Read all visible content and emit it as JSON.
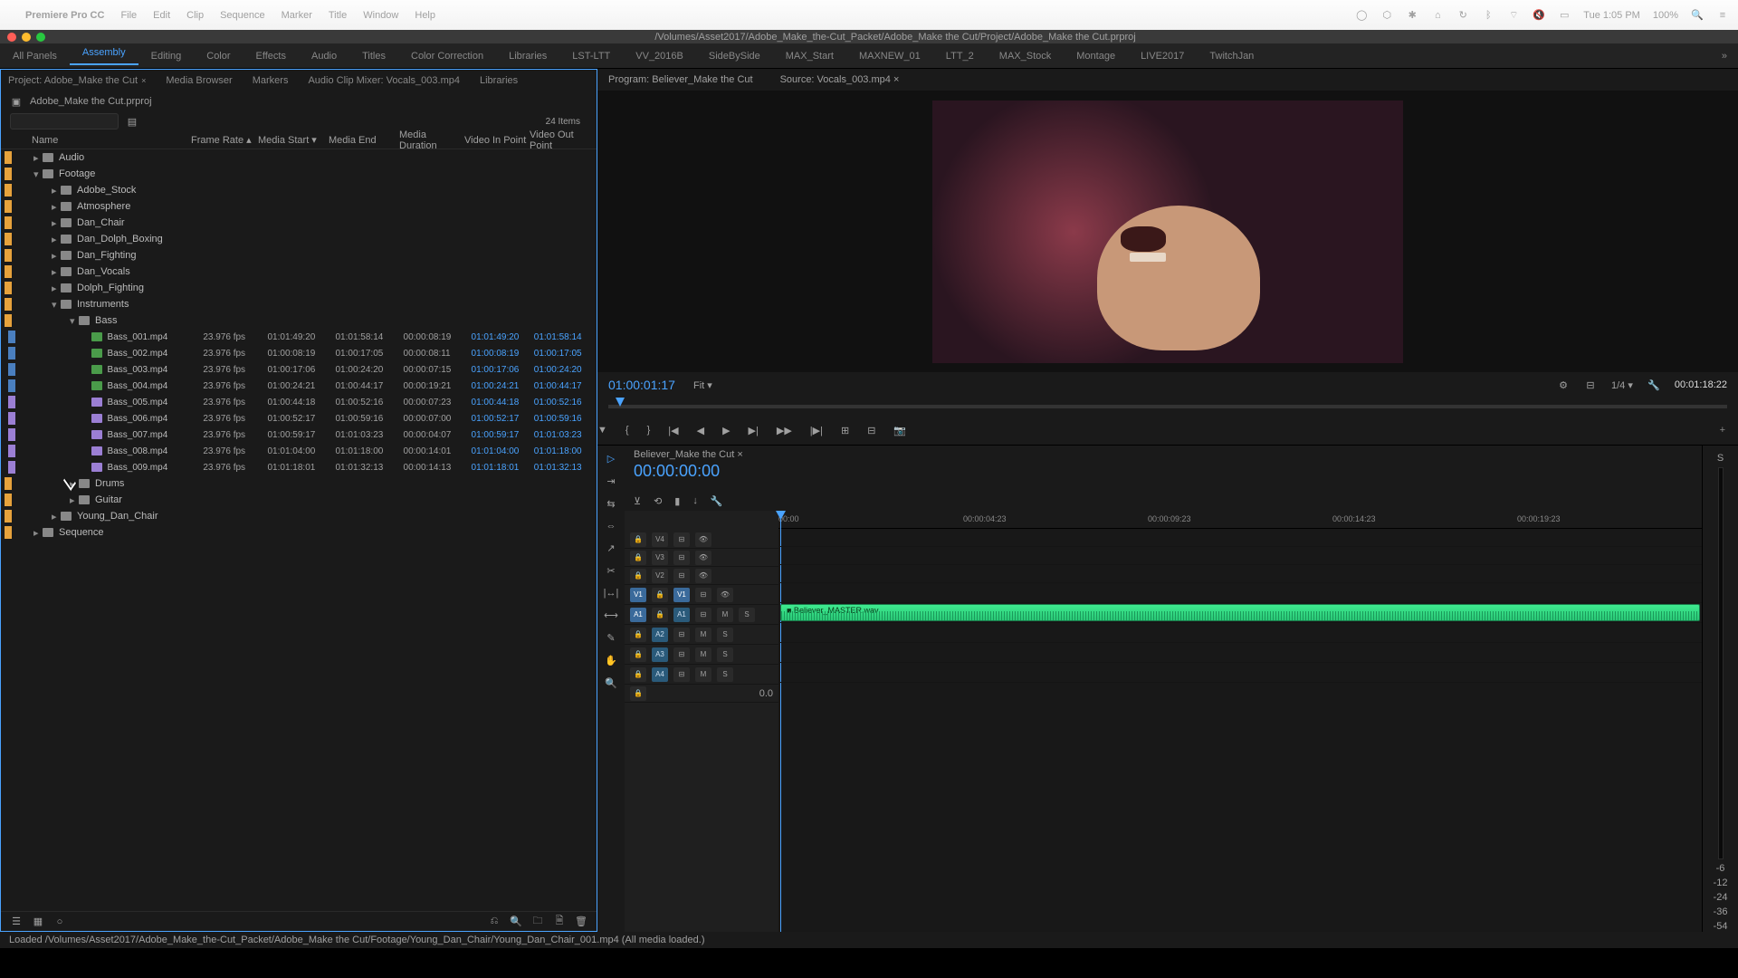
{
  "menubar": {
    "app": "Premiere Pro CC",
    "items": [
      "File",
      "Edit",
      "Clip",
      "Sequence",
      "Marker",
      "Title",
      "Window",
      "Help"
    ],
    "clock": "Tue 1:05 PM",
    "battery": "100%"
  },
  "window": {
    "title": "/Volumes/Asset2017/Adobe_Make_the-Cut_Packet/Adobe_Make the Cut/Project/Adobe_Make the Cut.prproj"
  },
  "workspaces": {
    "items": [
      "All Panels",
      "Assembly",
      "Editing",
      "Color",
      "Effects",
      "Audio",
      "Titles",
      "Color Correction",
      "Libraries",
      "LST-LTT",
      "VV_2016B",
      "SideBySide",
      "MAX_Start",
      "MAXNEW_01",
      "LTT_2",
      "MAX_Stock",
      "Montage",
      "LIVE2017",
      "TwitchJan"
    ],
    "active": "Assembly"
  },
  "project": {
    "tabs": [
      "Project: Adobe_Make the Cut",
      "Media Browser",
      "Markers",
      "Audio Clip Mixer: Vocals_003.mp4",
      "Libraries"
    ],
    "file": "Adobe_Make the Cut.prproj",
    "search_placeholder": "",
    "item_count": "24 Items",
    "columns": [
      "Name",
      "Frame Rate",
      "Media Start",
      "Media End",
      "Media Duration",
      "Video In Point",
      "Video Out Point"
    ],
    "folders": {
      "top": [
        "Audio",
        "Footage"
      ],
      "footage": [
        "Adobe_Stock",
        "Atmosphere",
        "Dan_Chair",
        "Dan_Dolph_Boxing",
        "Dan_Fighting",
        "Dan_Vocals",
        "Dolph_Fighting",
        "Instruments",
        "Young_Dan_Chair"
      ],
      "instruments": [
        "Bass",
        "Drums",
        "Guitar"
      ],
      "bottom": [
        "Sequence"
      ]
    },
    "clips": [
      {
        "name": "Bass_001.mp4",
        "fr": "23.976 fps",
        "ms": "01:01:49:20",
        "me": "01:01:58:14",
        "md": "00:00:08:19",
        "vi": "01:01:49:20",
        "vo": "01:01:58:14",
        "c": "blue",
        "t": "g"
      },
      {
        "name": "Bass_002.mp4",
        "fr": "23.976 fps",
        "ms": "01:00:08:19",
        "me": "01:00:17:05",
        "md": "00:00:08:11",
        "vi": "01:00:08:19",
        "vo": "01:00:17:05",
        "c": "blue",
        "t": "g"
      },
      {
        "name": "Bass_003.mp4",
        "fr": "23.976 fps",
        "ms": "01:00:17:06",
        "me": "01:00:24:20",
        "md": "00:00:07:15",
        "vi": "01:00:17:06",
        "vo": "01:00:24:20",
        "c": "blue",
        "t": "g"
      },
      {
        "name": "Bass_004.mp4",
        "fr": "23.976 fps",
        "ms": "01:00:24:21",
        "me": "01:00:44:17",
        "md": "00:00:19:21",
        "vi": "01:00:24:21",
        "vo": "01:00:44:17",
        "c": "blue",
        "t": "g"
      },
      {
        "name": "Bass_005.mp4",
        "fr": "23.976 fps",
        "ms": "01:00:44:18",
        "me": "01:00:52:16",
        "md": "00:00:07:23",
        "vi": "01:00:44:18",
        "vo": "01:00:52:16",
        "c": "purple",
        "t": "p"
      },
      {
        "name": "Bass_006.mp4",
        "fr": "23.976 fps",
        "ms": "01:00:52:17",
        "me": "01:00:59:16",
        "md": "00:00:07:00",
        "vi": "01:00:52:17",
        "vo": "01:00:59:16",
        "c": "purple",
        "t": "p"
      },
      {
        "name": "Bass_007.mp4",
        "fr": "23.976 fps",
        "ms": "01:00:59:17",
        "me": "01:01:03:23",
        "md": "00:00:04:07",
        "vi": "01:00:59:17",
        "vo": "01:01:03:23",
        "c": "purple",
        "t": "p"
      },
      {
        "name": "Bass_008.mp4",
        "fr": "23.976 fps",
        "ms": "01:01:04:00",
        "me": "01:01:18:00",
        "md": "00:00:14:01",
        "vi": "01:01:04:00",
        "vo": "01:01:18:00",
        "c": "purple",
        "t": "p"
      },
      {
        "name": "Bass_009.mp4",
        "fr": "23.976 fps",
        "ms": "01:01:18:01",
        "me": "01:01:32:13",
        "md": "00:00:14:13",
        "vi": "01:01:18:01",
        "vo": "01:01:32:13",
        "c": "purple",
        "t": "p"
      }
    ]
  },
  "monitor": {
    "program_tab": "Program: Believer_Make the Cut",
    "source_tab": "Source: Vocals_003.mp4",
    "timecode": "01:00:01:17",
    "fit": "Fit",
    "zoom": "1/4",
    "duration": "00:01:18:22"
  },
  "timeline": {
    "sequence": "Believer_Make the Cut",
    "timecode": "00:00:00:00",
    "ruler": [
      "00:00",
      "00:00:04:23",
      "00:00:09:23",
      "00:00:14:23",
      "00:00:19:23"
    ],
    "video_tracks": [
      "V4",
      "V3",
      "V2",
      "V1"
    ],
    "audio_tracks": [
      "A1",
      "A2",
      "A3",
      "A4"
    ],
    "clip_name": "Believer_MASTER.wav",
    "zoom": "0.0"
  },
  "status": "Loaded /Volumes/Asset2017/Adobe_Make_the-Cut_Packet/Adobe_Make the Cut/Footage/Young_Dan_Chair/Young_Dan_Chair_001.mp4 (All media loaded.)",
  "transport_icons": [
    "mark-in",
    "mark-out",
    "go-in",
    "step-back",
    "play",
    "step-fwd",
    "go-out",
    "next-edit",
    "lift",
    "extract",
    "export-frame"
  ]
}
